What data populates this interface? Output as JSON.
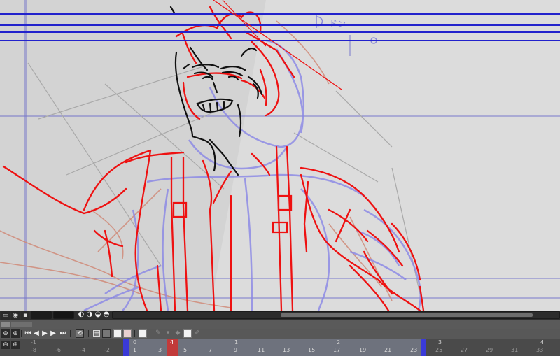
{
  "canvas": {
    "annotation_text": "ドン",
    "colors": {
      "paper": "#d6d6d6",
      "guide_blue": "#2222cc",
      "ink_black": "#111111",
      "ink_red": "#ee1111",
      "ink_violet": "#8a88e6",
      "ink_salmon": "#d28a78",
      "ink_grey": "#a7a7a7"
    }
  },
  "timeline": {
    "colors": {
      "panel": "#3c3c3c",
      "current_frame": "#c23a3a",
      "range_marker": "#3a3ad8",
      "range_band": "#8c93a8"
    },
    "current_frame_label": "4",
    "ruler_top": [
      "-1",
      "0",
      "1",
      "2",
      "3",
      "4"
    ],
    "ruler_bottom": [
      "-8",
      "-6",
      "-4",
      "-2",
      "1",
      "3",
      "5",
      "7",
      "9",
      "11",
      "13",
      "15",
      "17",
      "19",
      "21",
      "23",
      "25",
      "27",
      "29",
      "31",
      "33"
    ],
    "controls": [
      "goto-first-icon",
      "step-back-icon",
      "play-icon",
      "step-forward-icon",
      "goto-last-icon",
      "loop-icon",
      "onion-skin-icon",
      "light-table-icon",
      "cel-icon",
      "frame-settings-icon",
      "pen-icon",
      "mask-icon",
      "eraser-icon"
    ]
  }
}
